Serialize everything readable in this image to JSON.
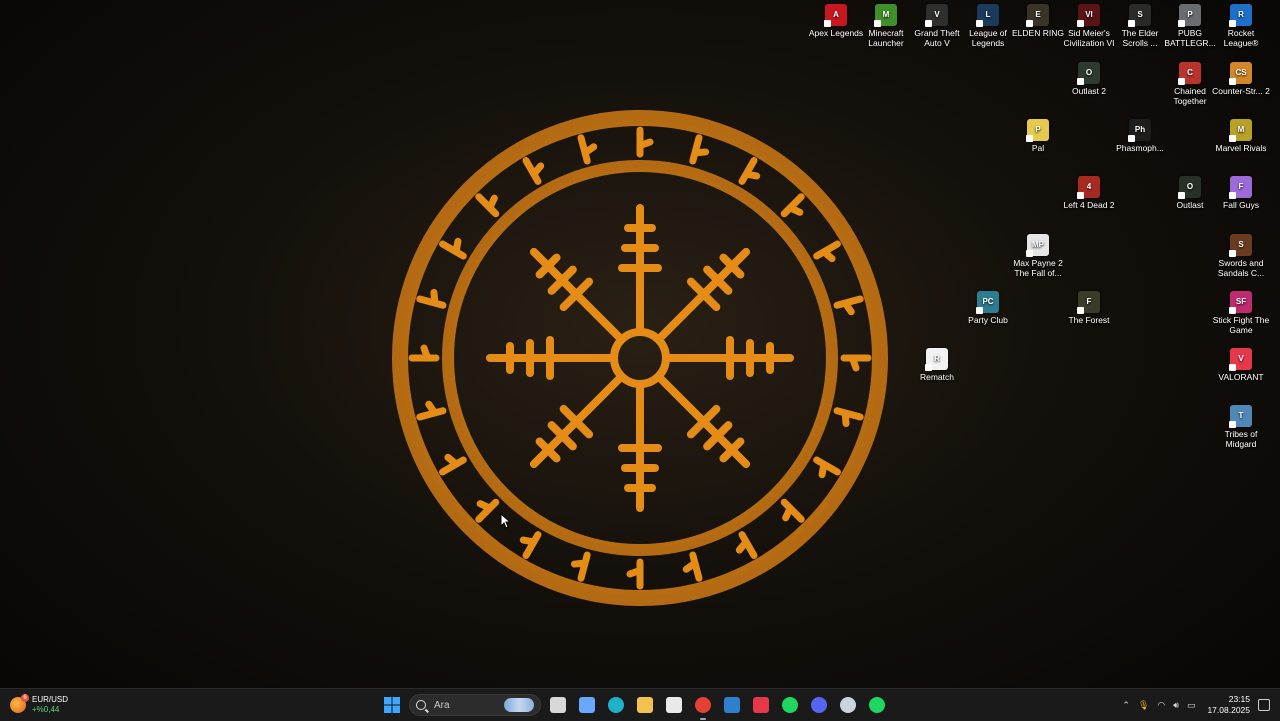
{
  "desktop": {
    "icons": [
      {
        "label": "Apex Legends",
        "color": "#c9171e",
        "glyph": "A"
      },
      {
        "label": "Minecraft Launcher",
        "color": "#3f8f2a",
        "glyph": "M"
      },
      {
        "label": "Grand Theft Auto V",
        "color": "#2f2f2f",
        "glyph": "V"
      },
      {
        "label": "League of Legends",
        "color": "#1b3a5c",
        "glyph": "L"
      },
      {
        "label": "ELDEN RING",
        "color": "#3a3428",
        "glyph": "E"
      },
      {
        "label": "Sid Meier's Civilization VI",
        "color": "#5a1416",
        "glyph": "VI"
      },
      {
        "label": "The Elder Scrolls ...",
        "color": "#2a2a2a",
        "glyph": "S"
      },
      {
        "label": "PUBG BATTLEGR...",
        "color": "#6a6d70",
        "glyph": "P"
      },
      {
        "label": "Rocket League®",
        "color": "#1e6fc9",
        "glyph": "R"
      },
      {
        "label": "Outlast 2",
        "color": "#2f3a2e",
        "glyph": "O"
      },
      {
        "label": "Chained Together",
        "color": "#b8342c",
        "glyph": "C"
      },
      {
        "label": "Counter-Str... 2",
        "color": "#d4862a",
        "glyph": "CS"
      },
      {
        "label": "Pal",
        "color": "#e7c94c",
        "glyph": "P"
      },
      {
        "label": "Phasmoph...",
        "color": "#1e1e1e",
        "glyph": "Ph"
      },
      {
        "label": "Marvel Rivals",
        "color": "#b8a127",
        "glyph": "M"
      },
      {
        "label": "Left 4 Dead 2",
        "color": "#a52a22",
        "glyph": "4"
      },
      {
        "label": "Outlast",
        "color": "#263226",
        "glyph": "O"
      },
      {
        "label": "Fall Guys",
        "color": "#9c6ad9",
        "glyph": "F"
      },
      {
        "label": "Max Payne 2 The Fall of...",
        "color": "#e6e6e6",
        "glyph": "MP"
      },
      {
        "label": "Swords and Sandals C...",
        "color": "#6b3b1f",
        "glyph": "S"
      },
      {
        "label": "Party Club",
        "color": "#2d7d92",
        "glyph": "PC"
      },
      {
        "label": "The Forest",
        "color": "#3b3b2a",
        "glyph": "F"
      },
      {
        "label": "Stick Fight The Game",
        "color": "#c02a6e",
        "glyph": "SF"
      },
      {
        "label": "Rematch",
        "color": "#f2f2f2",
        "glyph": "R"
      },
      {
        "label": "VALORANT",
        "color": "#e6384a",
        "glyph": "V"
      },
      {
        "label": "Tribes of Midgard",
        "color": "#4f88b8",
        "glyph": "T"
      }
    ]
  },
  "taskbar": {
    "widget": {
      "title": "EUR/USD",
      "value": "+%0,44",
      "badge": "6"
    },
    "search_placeholder": "Ara",
    "apps": [
      {
        "name": "start-button",
        "color": "#3ea6ff"
      },
      {
        "name": "task-view-button",
        "color": "#d8d8d8"
      },
      {
        "name": "copilot-button",
        "color": "#6aa8ff"
      },
      {
        "name": "edge-button",
        "color": "#1fb1c9"
      },
      {
        "name": "file-explorer-button",
        "color": "#f2c14e"
      },
      {
        "name": "store-button",
        "color": "#e9e9e9"
      },
      {
        "name": "chrome-button",
        "color": "#e44134"
      },
      {
        "name": "notepad-button",
        "color": "#2f7fcf"
      },
      {
        "name": "valorant-taskbar-button",
        "color": "#e6384a"
      },
      {
        "name": "spotify-button",
        "color": "#1ed760"
      },
      {
        "name": "discord-button",
        "color": "#5865f2"
      },
      {
        "name": "steam-button",
        "color": "#c7d5e0"
      },
      {
        "name": "spotify-alt-button",
        "color": "#1ed760"
      }
    ],
    "time": "23:15",
    "date": "17.08.2025"
  }
}
